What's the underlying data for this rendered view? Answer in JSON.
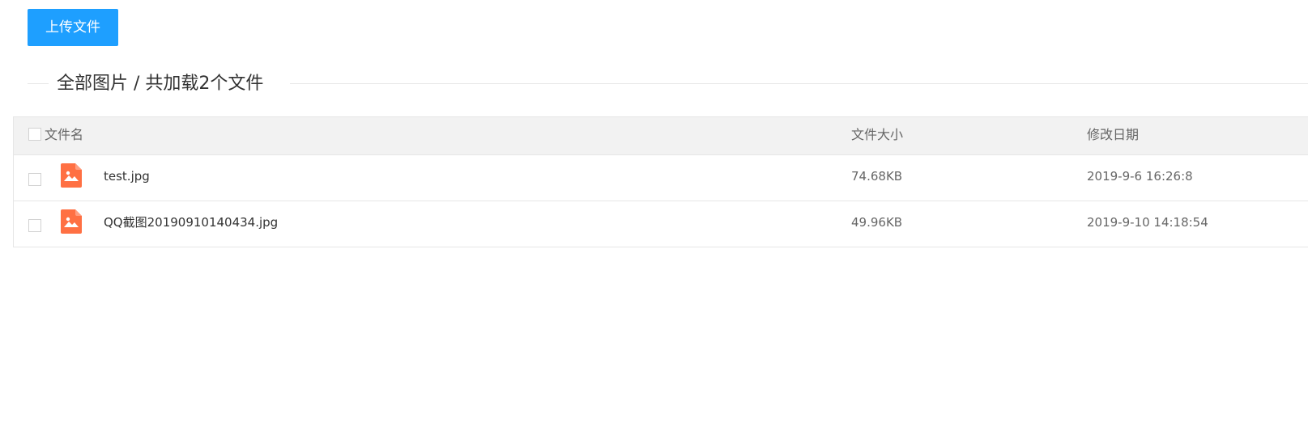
{
  "toolbar": {
    "upload_label": "上传文件",
    "accent_color": "#1e9fff"
  },
  "section": {
    "legend": "全部图片 / 共加载2个文件"
  },
  "table": {
    "headers": {
      "name": "文件名",
      "size": "文件大小",
      "date": "修改日期"
    },
    "rows": [
      {
        "icon": "image-file-icon",
        "name": "test.jpg",
        "size": "74.68KB",
        "date": "2019-9-6 16:26:8"
      },
      {
        "icon": "image-file-icon",
        "name": "QQ截图20190910140434.jpg",
        "size": "49.96KB",
        "date": "2019-9-10 14:18:54"
      }
    ],
    "icon_color": "#ff7043"
  }
}
